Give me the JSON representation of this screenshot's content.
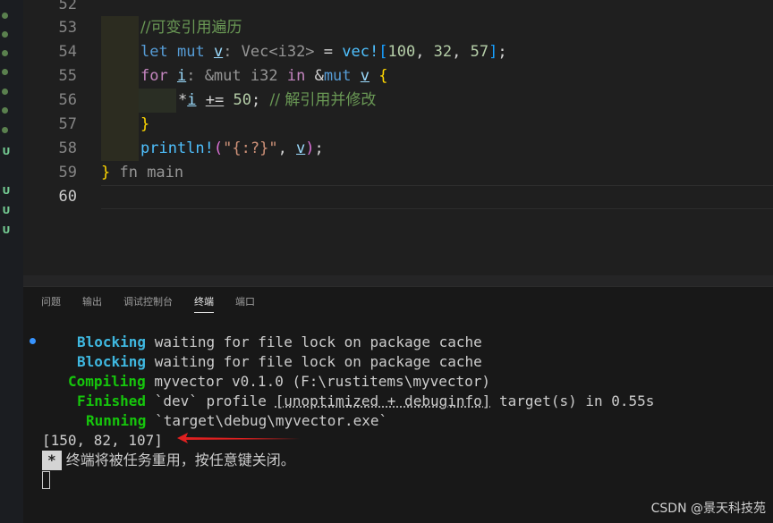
{
  "gutter": {
    "marks": [
      "U",
      "U",
      "U",
      "U"
    ]
  },
  "editor": {
    "line_numbers": [
      "52",
      "53",
      "54",
      "55",
      "56",
      "57",
      "58",
      "59",
      "60"
    ],
    "active_line": "60",
    "code": {
      "l53_comment": "//可变引用遍历",
      "l54": {
        "let": "let",
        "mut": "mut",
        "var": "v",
        "hint": ": Vec<i32>",
        "eq": " = ",
        "macro": "vec!",
        "open": "[",
        "n1": "100",
        "c1": ", ",
        "n2": "32",
        "c2": ", ",
        "n3": "57",
        "close": "]",
        "semi": ";"
      },
      "l55": {
        "for": "for",
        "var": "i",
        "hint": ": &mut i32",
        "in": "in",
        "amp": "&",
        "mut": "mut",
        "v": "v",
        "brace": "{"
      },
      "l56": {
        "deref": "*",
        "var": "i",
        "op": "+=",
        "num": "50",
        "semi": ";",
        "comment": "// 解引用并修改"
      },
      "l57": {
        "brace": "}"
      },
      "l58": {
        "macro": "println!",
        "open": "(",
        "str": "\"{:?}\"",
        "comma": ", ",
        "v": "v",
        "close": ")",
        "semi": ";"
      },
      "l59": {
        "brace": "}",
        "hint": " fn main"
      }
    }
  },
  "panel": {
    "tabs": [
      {
        "label": "问题",
        "active": false
      },
      {
        "label": "输出",
        "active": false
      },
      {
        "label": "调试控制台",
        "active": false
      },
      {
        "label": "终端",
        "active": true
      },
      {
        "label": "端口",
        "active": false
      }
    ],
    "terminal": {
      "lines": [
        {
          "status": "Blocking",
          "text": " waiting for file lock on package cache"
        },
        {
          "status": "Blocking",
          "text": " waiting for file lock on package cache"
        },
        {
          "status": "Compiling",
          "text": " myvector v0.1.0 (F:\\rustitems\\myvector)"
        },
        {
          "status": "Finished",
          "text_a": " `dev` profile ",
          "text_u": "[unoptimized + debuginfo]",
          "text_b": " target(s) in 0.55s"
        },
        {
          "status": "Running",
          "text": " `target\\debug\\myvector.exe`"
        }
      ],
      "output": "[150, 82, 107]",
      "notice_star": "*",
      "notice_text": " 终端将被任务重用，按任意键关闭。"
    }
  },
  "watermark": "CSDN @景天科技苑",
  "colors": {
    "accent_blue": "#3fb8e0",
    "accent_green": "#16c60c",
    "arrow_red": "#e02020"
  }
}
